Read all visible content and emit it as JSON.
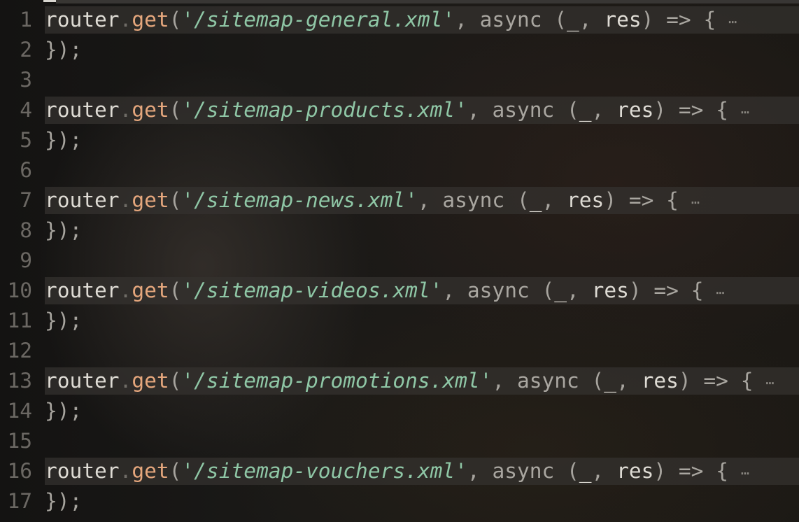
{
  "editor": {
    "lines": [
      {
        "number": "1",
        "folded": true,
        "receiver": "router",
        "dot": ".",
        "method": "get",
        "open": "(",
        "route": "'/sitemap-general.xml'",
        "comma": ",",
        "keyword": "async",
        "params_open": "(",
        "param1": "_",
        "sep": ",",
        "param2": "res",
        "params_close": ")",
        "arrow": "=>",
        "brace": "{",
        "ellipsis": "⋯"
      },
      {
        "number": "2",
        "closing": "});"
      },
      {
        "number": "3",
        "blank": true
      },
      {
        "number": "4",
        "folded": true,
        "receiver": "router",
        "dot": ".",
        "method": "get",
        "open": "(",
        "route": "'/sitemap-products.xml'",
        "comma": ",",
        "keyword": "async",
        "params_open": "(",
        "param1": "_",
        "sep": ",",
        "param2": "res",
        "params_close": ")",
        "arrow": "=>",
        "brace": "{",
        "ellipsis": "⋯"
      },
      {
        "number": "5",
        "closing": "});"
      },
      {
        "number": "6",
        "blank": true
      },
      {
        "number": "7",
        "folded": true,
        "receiver": "router",
        "dot": ".",
        "method": "get",
        "open": "(",
        "route": "'/sitemap-news.xml'",
        "comma": ",",
        "keyword": "async",
        "params_open": "(",
        "param1": "_",
        "sep": ",",
        "param2": "res",
        "params_close": ")",
        "arrow": "=>",
        "brace": "{",
        "ellipsis": "⋯"
      },
      {
        "number": "8",
        "closing": "});"
      },
      {
        "number": "9",
        "blank": true
      },
      {
        "number": "10",
        "folded": true,
        "receiver": "router",
        "dot": ".",
        "method": "get",
        "open": "(",
        "route": "'/sitemap-videos.xml'",
        "comma": ",",
        "keyword": "async",
        "params_open": "(",
        "param1": "_",
        "sep": ",",
        "param2": "res",
        "params_close": ")",
        "arrow": "=>",
        "brace": "{",
        "ellipsis": "⋯"
      },
      {
        "number": "11",
        "closing": "});"
      },
      {
        "number": "12",
        "blank": true
      },
      {
        "number": "13",
        "folded": true,
        "receiver": "router",
        "dot": ".",
        "method": "get",
        "open": "(",
        "route": "'/sitemap-promotions.xml'",
        "comma": ",",
        "keyword": "async",
        "params_open": "(",
        "param1": "_",
        "sep": ",",
        "param2": "res",
        "params_close": ")",
        "arrow": "=>",
        "brace": "{",
        "ellipsis": "⋯"
      },
      {
        "number": "14",
        "closing": "});"
      },
      {
        "number": "15",
        "blank": true
      },
      {
        "number": "16",
        "folded": true,
        "receiver": "router",
        "dot": ".",
        "method": "get",
        "open": "(",
        "route": "'/sitemap-vouchers.xml'",
        "comma": ",",
        "keyword": "async",
        "params_open": "(",
        "param1": "_",
        "sep": ",",
        "param2": "res",
        "params_close": ")",
        "arrow": "=>",
        "brace": "{",
        "ellipsis": "⋯"
      },
      {
        "number": "17",
        "closing": "});"
      }
    ]
  },
  "colors": {
    "string": "#8fc7a6",
    "method": "#e5a77d",
    "identifier": "#dedbd4",
    "line_number": "#6b6863",
    "fold_highlight": "#34322f"
  }
}
